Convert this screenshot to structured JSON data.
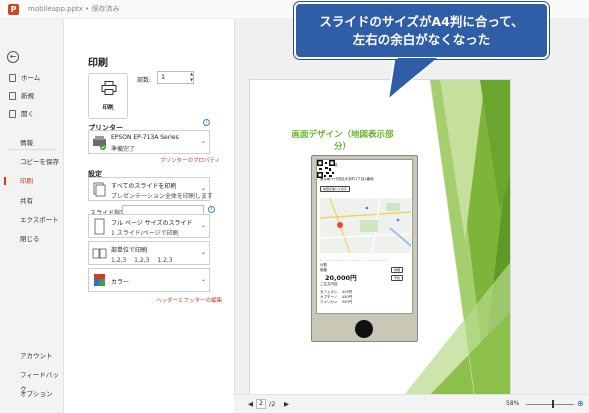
{
  "titlebar": {
    "app_icon": "P",
    "doc_title": "mobileapp.pptx • 保存済み"
  },
  "nav": {
    "items": [
      {
        "label": "ホーム",
        "icon": "home-icon"
      },
      {
        "label": "新規",
        "icon": "new-icon"
      },
      {
        "label": "開く",
        "icon": "open-icon"
      },
      {
        "label": "情報"
      },
      {
        "label": "コピーを保存"
      },
      {
        "label": "印刷"
      },
      {
        "label": "共有"
      },
      {
        "label": "エクスポート"
      },
      {
        "label": "閉じる"
      }
    ],
    "bottom_items": [
      {
        "label": "アカウント"
      },
      {
        "label": "フィードバック"
      },
      {
        "label": "オプション"
      }
    ]
  },
  "print": {
    "heading": "印刷",
    "print_button_label": "印刷",
    "copies_label": "部数:",
    "copies_value": "1",
    "printer_section": "プリンター",
    "printer_name": "EPSON EP-713A Series",
    "printer_status": "準備完了",
    "printer_props_link": "プリンターのプロパティ",
    "settings_section": "設定",
    "range_line1": "すべてのスライドを印刷",
    "range_line2": "プレゼンテーション全体を印刷します",
    "slides_label": "スライド指定:",
    "layout_line1": "フル ページ サイズのスライド",
    "layout_line2": "1 スライド/ページで印刷",
    "collate_line1": "部単位で印刷",
    "collate_line2": "1,2,3　 1,2,3　 1,2,3",
    "color_label": "カラー",
    "header_footer_link": "ヘッダーとフッターの編集"
  },
  "preview": {
    "slide_title_line1": "画面デザイン（地図表示部",
    "slide_title_line2": "分）",
    "phone": {
      "header": "ぼくの出品",
      "shop_name": "大手町",
      "address": "東京都千代田区大手町1丁目1番地",
      "route_button": "地図を開いて表示",
      "price_label": "価格",
      "price_value": "20,000円",
      "menu_rows": [
        "カフェオレ　 400円",
        "カプチーノ　 450円",
        "アメリカン　 350円"
      ],
      "small_button_1": "詳細",
      "small_button_2": "予約",
      "meta_1": "分数",
      "meta_2": "5分",
      "menu_title": "ご注文内容"
    }
  },
  "statusbar": {
    "page_current": "2",
    "page_total": "/2",
    "zoom": "58%"
  },
  "callout": {
    "line1": "スライドのサイズがA4判に合って、",
    "line2": "左右の余白がなくなった"
  },
  "colors": {
    "accent": "#c43e1c",
    "callout": "#2f5da6",
    "slide_green": "#6ab42c"
  }
}
